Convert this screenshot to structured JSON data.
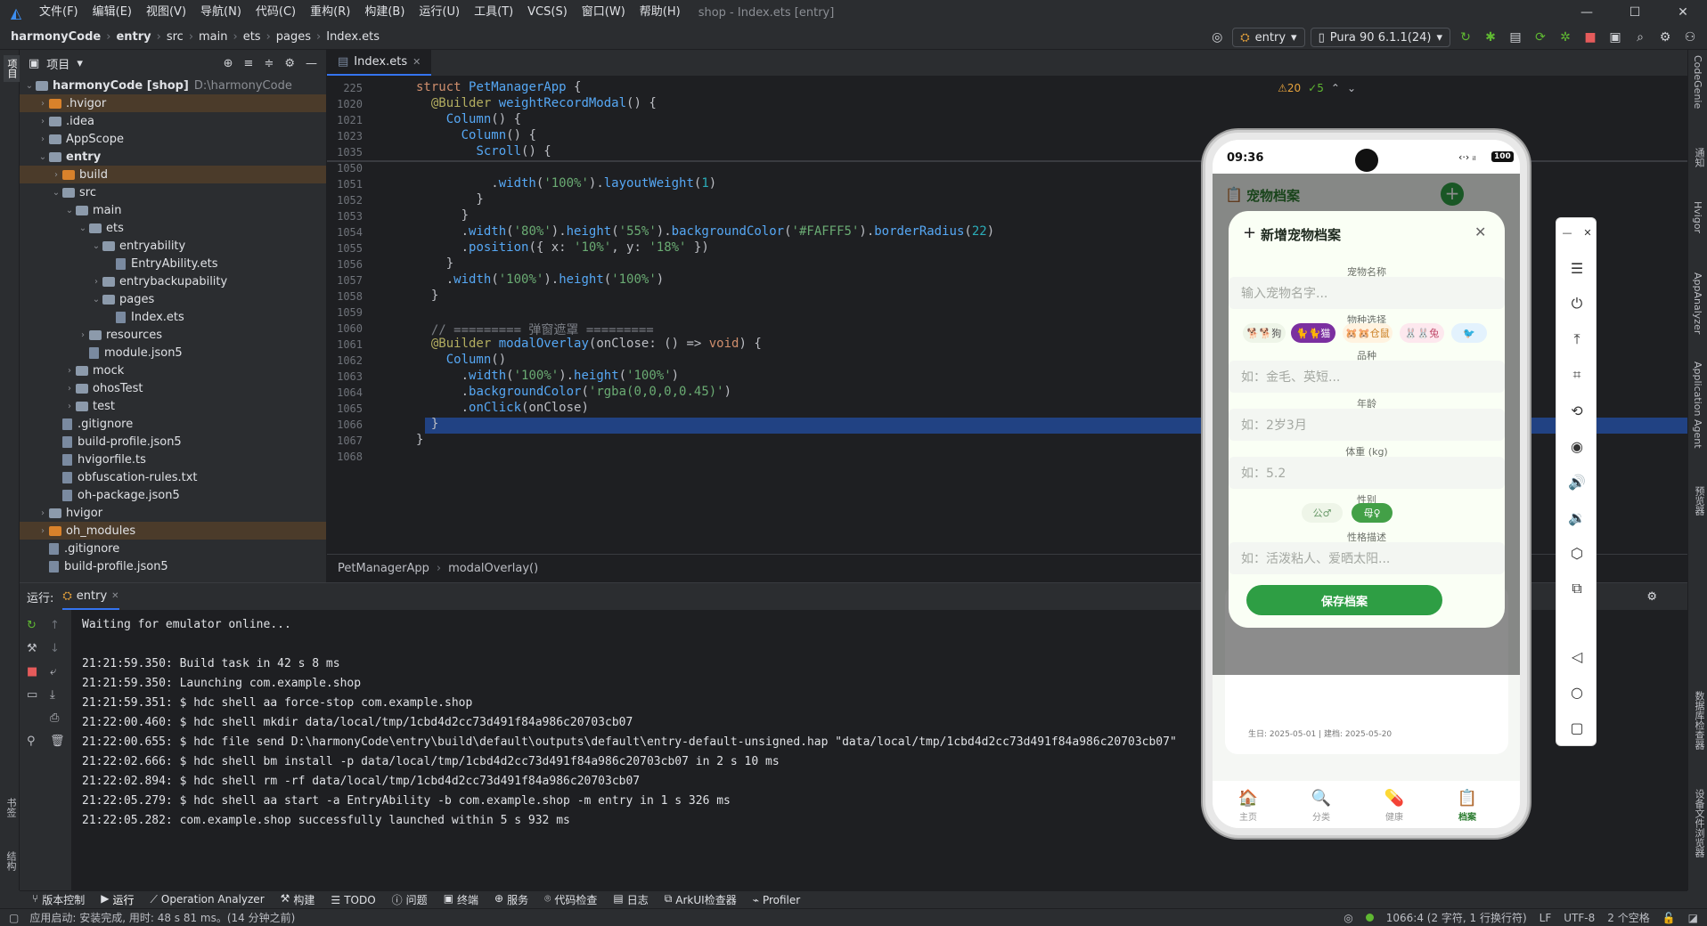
{
  "menu": {
    "items": [
      "文件(F)",
      "编辑(E)",
      "视图(V)",
      "导航(N)",
      "代码(C)",
      "重构(R)",
      "构建(B)",
      "运行(U)",
      "工具(T)",
      "VCS(S)",
      "窗口(W)",
      "帮助(H)"
    ],
    "window_title": "shop - Index.ets [entry]"
  },
  "breadcrumb": [
    "harmonyCode",
    "entry",
    "src",
    "main",
    "ets",
    "pages",
    "Index.ets"
  ],
  "toolbar": {
    "module": "entry",
    "device": "Pura 90 6.1.1(24)"
  },
  "project": {
    "title": "项目",
    "tree": [
      {
        "label": "harmonyCode [shop]",
        "hint": "D:\\harmonyCode",
        "depth": 0,
        "type": "folder",
        "open": true
      },
      {
        "label": ".hvigor",
        "depth": 1,
        "type": "folder-o",
        "hl": true
      },
      {
        "label": ".idea",
        "depth": 1,
        "type": "folder"
      },
      {
        "label": "AppScope",
        "depth": 1,
        "type": "folder"
      },
      {
        "label": "entry",
        "depth": 1,
        "type": "folder",
        "open": true,
        "bold": true
      },
      {
        "label": "build",
        "depth": 2,
        "type": "folder-o",
        "hl": true
      },
      {
        "label": "src",
        "depth": 2,
        "type": "folder",
        "open": true
      },
      {
        "label": "main",
        "depth": 3,
        "type": "folder",
        "open": true
      },
      {
        "label": "ets",
        "depth": 4,
        "type": "folder",
        "open": true
      },
      {
        "label": "entryability",
        "depth": 5,
        "type": "folder",
        "open": true
      },
      {
        "label": "EntryAbility.ets",
        "depth": 6,
        "type": "file"
      },
      {
        "label": "entrybackupability",
        "depth": 5,
        "type": "folder"
      },
      {
        "label": "pages",
        "depth": 5,
        "type": "folder",
        "open": true
      },
      {
        "label": "Index.ets",
        "depth": 6,
        "type": "file"
      },
      {
        "label": "resources",
        "depth": 4,
        "type": "folder"
      },
      {
        "label": "module.json5",
        "depth": 4,
        "type": "file"
      },
      {
        "label": "mock",
        "depth": 3,
        "type": "folder"
      },
      {
        "label": "ohosTest",
        "depth": 3,
        "type": "folder"
      },
      {
        "label": "test",
        "depth": 3,
        "type": "folder"
      },
      {
        "label": ".gitignore",
        "depth": 2,
        "type": "file"
      },
      {
        "label": "build-profile.json5",
        "depth": 2,
        "type": "file"
      },
      {
        "label": "hvigorfile.ts",
        "depth": 2,
        "type": "file"
      },
      {
        "label": "obfuscation-rules.txt",
        "depth": 2,
        "type": "file"
      },
      {
        "label": "oh-package.json5",
        "depth": 2,
        "type": "file"
      },
      {
        "label": "hvigor",
        "depth": 1,
        "type": "folder"
      },
      {
        "label": "oh_modules",
        "depth": 1,
        "type": "folder-o",
        "hl": true
      },
      {
        "label": ".gitignore",
        "depth": 1,
        "type": "file"
      },
      {
        "label": "build-profile.json5",
        "depth": 1,
        "type": "file"
      }
    ]
  },
  "editor": {
    "tab": "Index.ets",
    "warnings": "⚠20",
    "checks": "✓5",
    "lines": [
      {
        "n": "225",
        "t": "struct PetManagerApp {"
      },
      {
        "n": "1020",
        "t": "  @Builder weightRecordModal() {"
      },
      {
        "n": "1021",
        "t": "    Column() {"
      },
      {
        "n": "1023",
        "t": "      Column() {"
      },
      {
        "n": "1035",
        "t": "        Scroll() {"
      },
      {
        "n": "1050",
        "t": ""
      },
      {
        "n": "1051",
        "t": "          .width('100%').layoutWeight(1)"
      },
      {
        "n": "1052",
        "t": "        }"
      },
      {
        "n": "1053",
        "t": "      }"
      },
      {
        "n": "1054",
        "t": "      .width('80%').height('55%').backgroundColor('#FAFFF5').borderRadius(22)"
      },
      {
        "n": "1055",
        "t": "      .position({ x: '10%', y: '18%' })"
      },
      {
        "n": "1056",
        "t": "    }"
      },
      {
        "n": "1057",
        "t": "    .width('100%').height('100%')"
      },
      {
        "n": "1058",
        "t": "  }"
      },
      {
        "n": "1059",
        "t": ""
      },
      {
        "n": "1060",
        "t": "  // ========= 弹窗遮罩 ========="
      },
      {
        "n": "1061",
        "t": "  @Builder modalOverlay(onClose: () => void) {"
      },
      {
        "n": "1062",
        "t": "    Column()"
      },
      {
        "n": "1063",
        "t": "      .width('100%').height('100%')"
      },
      {
        "n": "1064",
        "t": "      .backgroundColor('rgba(0,0,0,0.45)')"
      },
      {
        "n": "1065",
        "t": "      .onClick(onClose)"
      },
      {
        "n": "1066",
        "t": "  }"
      },
      {
        "n": "1067",
        "t": "}"
      },
      {
        "n": "1068",
        "t": ""
      }
    ],
    "footer": [
      "PetManagerApp",
      "modalOverlay()"
    ]
  },
  "run": {
    "label": "运行:",
    "config": "entry",
    "console": [
      "Waiting for emulator online...",
      "",
      "21:21:59.350: Build task in 42 s 8 ms",
      "21:21:59.350: Launching com.example.shop",
      "21:21:59.351: $ hdc shell aa force-stop com.example.shop",
      "21:22:00.460: $ hdc shell mkdir data/local/tmp/1cbd4d2cc73d491f84a986c20703cb07",
      "21:22:00.655: $ hdc file send D:\\harmonyCode\\entry\\build\\default\\outputs\\default\\entry-default-unsigned.hap \"data/local/tmp/1cbd4d2cc73d491f84a986c20703cb07\"",
      "21:22:02.666: $ hdc shell bm install -p data/local/tmp/1cbd4d2cc73d491f84a986c20703cb07 in 2 s 10 ms",
      "21:22:02.894: $ hdc shell rm -rf data/local/tmp/1cbd4d2cc73d491f84a986c20703cb07",
      "21:22:05.279: $ hdc shell aa start -a EntryAbility -b com.example.shop -m entry in 1 s 326 ms",
      "21:22:05.282: com.example.shop successfully launched within 5 s 932 ms"
    ]
  },
  "toolstrip": [
    "版本控制",
    "运行",
    "Operation Analyzer",
    "构建",
    "TODO",
    "问题",
    "终端",
    "服务",
    "代码检查",
    "日志",
    "ArkUI检查器",
    "Profiler"
  ],
  "status": {
    "message": "应用启动: 安装完成, 用时: 48 s 81 ms。(14 分钟之前)",
    "position": "1066:4 (2 字符, 1 行换行符)",
    "line_sep": "LF",
    "encoding": "UTF-8",
    "indent": "2 个空格"
  },
  "right_tools": [
    "CodeGenie",
    "通知",
    "Hvigor",
    "AppAnalyzer",
    "Application Agent",
    "预览器",
    "数据库检查器",
    "设备文件浏览器"
  ],
  "left_tools": [
    "项目",
    "书签",
    "结构"
  ],
  "phone": {
    "time": "09:36",
    "battery": "100",
    "page_title": "宠物档案",
    "modal_title": "新增宠物档案",
    "fields": {
      "name_label": "宠物名称",
      "name_ph": "输入宠物名字...",
      "species_label": "物种选择",
      "species": [
        "🐕🐕狗",
        "🐈🐈猫",
        "🐹🐹仓鼠",
        "🐰🐰兔"
      ],
      "breed_label": "品种",
      "breed_ph": "如：金毛、英短...",
      "age_label": "年龄",
      "age_ph": "如：2岁3月",
      "weight_label": "体重 (kg)",
      "weight_ph": "如：5.2",
      "gender_label": "性别",
      "genders": [
        "公♂",
        "母♀"
      ],
      "desc_label": "性格描述",
      "desc_ph": "如：活泼粘人、爱晒太阳..."
    },
    "save_label": "保存档案",
    "bg_line": "生日: 2025-05-01 | 建档: 2025-05-20",
    "nav": [
      "主页",
      "分类",
      "健康",
      "档案"
    ]
  }
}
